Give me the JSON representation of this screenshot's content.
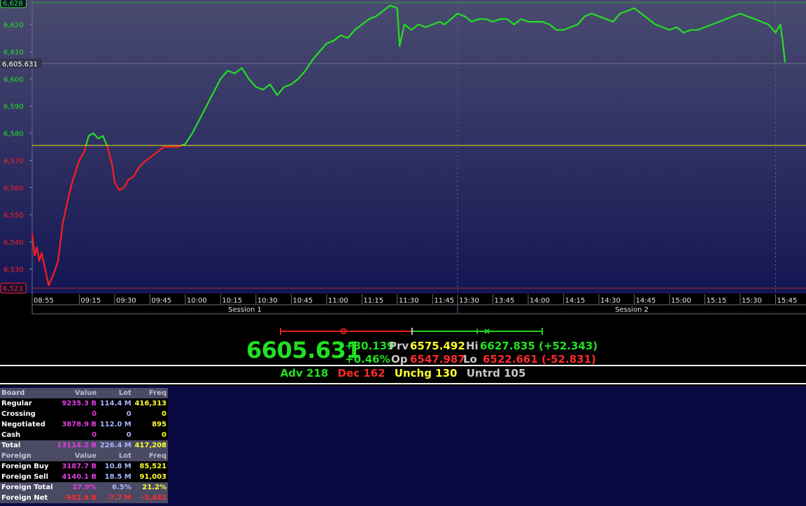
{
  "chart_data": {
    "type": "line",
    "title": "",
    "xlabel": "",
    "ylabel": "",
    "ylim": [
      6521,
      6629
    ],
    "y_ticks": [
      "6,530",
      "6,540",
      "6,550",
      "6,560",
      "6,570",
      "6,580",
      "6,590",
      "6,600",
      "6,610",
      "6,620"
    ],
    "x_ticks": [
      "08:55",
      "09:15",
      "09:30",
      "09:45",
      "10:00",
      "10:15",
      "10:30",
      "10:45",
      "11:00",
      "11:15",
      "11:30",
      "11:45",
      "13:30",
      "13:45",
      "14:00",
      "14:15",
      "14:30",
      "14:45",
      "15:00",
      "15:15",
      "15:30",
      "15:45"
    ],
    "sessions": [
      "Session 1",
      "Session 2"
    ],
    "high_marker": "6,628",
    "low_marker": "6,523",
    "last_marker": "6,605.631",
    "previous_close": 6575.492,
    "grid": false,
    "colors": {
      "above_prev": "#22e022",
      "below_prev": "#ff1e1e",
      "prev_line": "#e6e617"
    },
    "series": [
      {
        "x": [
          "08:55",
          "08:56",
          "08:57",
          "08:58",
          "08:59",
          "09:00",
          "09:02",
          "09:04",
          "09:06",
          "09:08",
          "09:10",
          "09:12",
          "09:15",
          "09:17",
          "09:19",
          "09:21",
          "09:23",
          "09:25",
          "09:27",
          "09:29",
          "09:30",
          "09:32",
          "09:34",
          "09:36",
          "09:38",
          "09:40",
          "09:42",
          "09:45",
          "09:48",
          "09:51",
          "09:54",
          "09:57",
          "10:00",
          "10:03",
          "10:06",
          "10:09",
          "10:12",
          "10:15",
          "10:18",
          "10:21",
          "10:24",
          "10:27",
          "10:30",
          "10:33",
          "10:36",
          "10:39",
          "10:42",
          "10:45",
          "10:48",
          "10:51",
          "10:54",
          "10:57",
          "11:00",
          "11:03",
          "11:06",
          "11:09",
          "11:12",
          "11:15",
          "11:18",
          "11:21",
          "11:24",
          "11:27",
          "11:30",
          "11:31",
          "11:33",
          "11:36",
          "11:39",
          "11:42",
          "11:45",
          "11:48",
          "11:50",
          "13:30",
          "13:33",
          "13:36",
          "13:39",
          "13:42",
          "13:45",
          "13:48",
          "13:51",
          "13:54",
          "13:57",
          "14:00",
          "14:03",
          "14:06",
          "14:09",
          "14:12",
          "14:15",
          "14:18",
          "14:21",
          "14:24",
          "14:27",
          "14:30",
          "14:33",
          "14:36",
          "14:39",
          "14:42",
          "14:45",
          "14:48",
          "14:51",
          "14:54",
          "14:57",
          "15:00",
          "15:03",
          "15:06",
          "15:09",
          "15:12",
          "15:15",
          "15:18",
          "15:21",
          "15:24",
          "15:27",
          "15:30",
          "15:33",
          "15:36",
          "15:39",
          "15:42",
          "15:45",
          "15:47",
          "15:48",
          "15:49"
        ],
        "values": [
          6543,
          6535,
          6538,
          6533,
          6536,
          6532,
          6524,
          6528,
          6533,
          6547,
          6555,
          6562,
          6570,
          6573,
          6579,
          6580,
          6578,
          6579,
          6575,
          6568,
          6562,
          6559,
          6560,
          6563,
          6564,
          6567,
          6569,
          6571,
          6573,
          6575,
          6575,
          6575,
          6576,
          6580,
          6585,
          6590,
          6595,
          6600,
          6603,
          6602,
          6604,
          6600,
          6597,
          6596,
          6598,
          6594,
          6597,
          6598,
          6600,
          6603,
          6607,
          6610,
          6613,
          6614,
          6616,
          6615,
          6618,
          6620,
          6622,
          6623,
          6625,
          6627,
          6626,
          6612,
          6620,
          6618,
          6620,
          6619,
          6620,
          6621,
          6620,
          6624,
          6623,
          6621,
          6622,
          6622,
          6621,
          6622,
          6622,
          6620,
          6622,
          6621,
          6621,
          6621,
          6620,
          6618,
          6618,
          6619,
          6620,
          6623,
          6624,
          6623,
          6622,
          6621,
          6624,
          6625,
          6626,
          6624,
          6622,
          6620,
          6619,
          6618,
          6619,
          6617,
          6618,
          6618,
          6619,
          6620,
          6621,
          6622,
          6623,
          6624,
          6623,
          6622,
          6621,
          6620,
          6617,
          6620,
          6614,
          6606
        ]
      }
    ]
  },
  "summary": {
    "last": "6605.631",
    "change": "+30.139",
    "change_pct": "+0.46%",
    "prv_label": "Prv",
    "prv_value": "6575.492",
    "op_label": "Op",
    "op_value": "6547.987",
    "hi_label": "Hi",
    "hi_value": "6627.835 (+52.343)",
    "lo_label": "Lo",
    "lo_value": "6522.661 (-52.831)",
    "range_bar": {
      "low": 6522.661,
      "open": 6547.987,
      "prev": 6575.492,
      "last": 6605.631,
      "high": 6627.835
    },
    "adv": "Adv 218",
    "dec": "Dec 162",
    "unchg": "Unchg 130",
    "untrd": "Untrd 105"
  },
  "board": {
    "headers": [
      "Board",
      "Value",
      "Lot",
      "Freq"
    ],
    "rows": [
      {
        "label": "Regular",
        "value": "9235.3 B",
        "lot": "114.4 M",
        "freq": "416,313"
      },
      {
        "label": "Crossing",
        "value": "0",
        "lot": "0",
        "freq": "0"
      },
      {
        "label": "Negotiated",
        "value": "3878.9 B",
        "lot": "112.0 M",
        "freq": "895"
      },
      {
        "label": "Cash",
        "value": "0",
        "lot": "0",
        "freq": "0"
      }
    ],
    "total": {
      "label": "Total",
      "value": "13114.2 B",
      "lot": "226.4 M",
      "freq": "417,208"
    },
    "foreign_headers": [
      "Foreign",
      "Value",
      "Lot",
      "Freq"
    ],
    "foreign_rows": [
      {
        "label": "Foreign Buy",
        "value": "3187.7 B",
        "lot": "10.8 M",
        "freq": "85,521"
      },
      {
        "label": "Foreign Sell",
        "value": "4140.1 B",
        "lot": "18.5 M",
        "freq": "91,003"
      }
    ],
    "foreign_total": {
      "label": "Foreign Total",
      "value": "27.9%",
      "lot": "6.5%",
      "freq": "21.2%"
    },
    "foreign_net": {
      "label": "Foreign Net",
      "value": "-952.4 B",
      "lot": "-7.7 M",
      "freq": "-5,482"
    }
  }
}
